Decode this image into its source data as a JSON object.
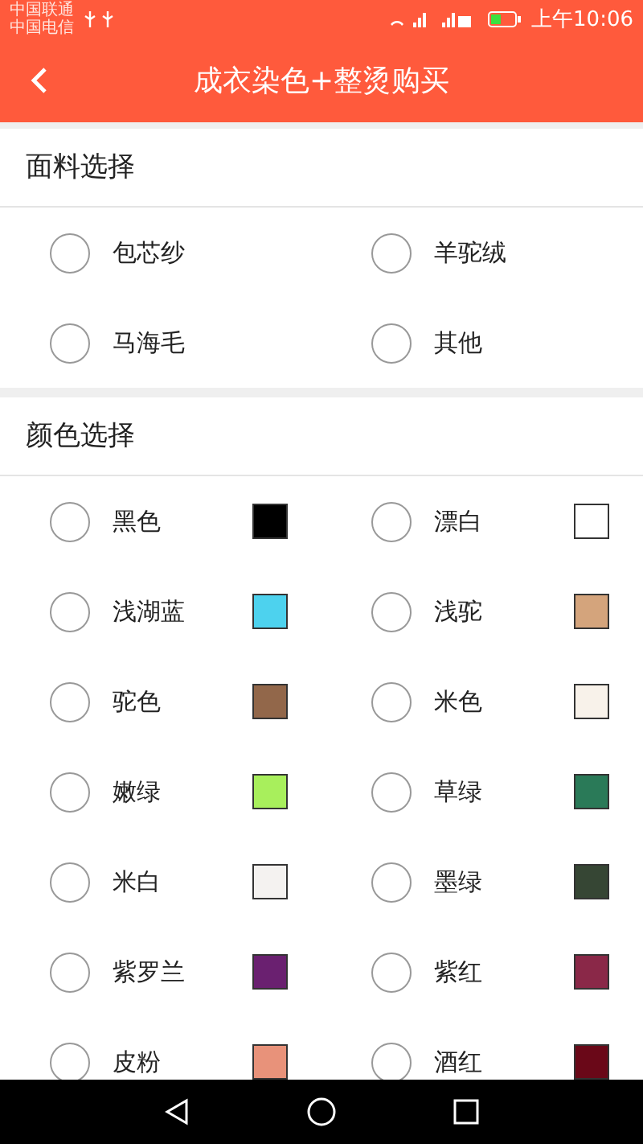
{
  "status_bar": {
    "carriers": [
      "中国联通",
      "中国电信"
    ],
    "time": "上午10:06"
  },
  "app_bar": {
    "title": "成衣染色+整烫购买"
  },
  "fabric_section": {
    "title": "面料选择",
    "options": [
      {
        "label": "包芯纱",
        "selected": false
      },
      {
        "label": "羊驼绒",
        "selected": false
      },
      {
        "label": "马海毛",
        "selected": false
      },
      {
        "label": "其他",
        "selected": false
      }
    ]
  },
  "color_section": {
    "title": "颜色选择",
    "options": [
      {
        "label": "黑色",
        "selected": false,
        "color": "#000000"
      },
      {
        "label": "漂白",
        "selected": false,
        "color": "#ffffff"
      },
      {
        "label": "浅湖蓝",
        "selected": false,
        "color": "#4dd2ee"
      },
      {
        "label": "浅驼",
        "selected": false,
        "color": "#d4a47c"
      },
      {
        "label": "驼色",
        "selected": false,
        "color": "#92674a"
      },
      {
        "label": "米色",
        "selected": false,
        "color": "#f8f2ea"
      },
      {
        "label": "嫩绿",
        "selected": false,
        "color": "#a8ef5c"
      },
      {
        "label": "草绿",
        "selected": false,
        "color": "#2a7a58"
      },
      {
        "label": "米白",
        "selected": false,
        "color": "#f4f2f0"
      },
      {
        "label": "墨绿",
        "selected": false,
        "color": "#364634"
      },
      {
        "label": "紫罗兰",
        "selected": false,
        "color": "#6a2070"
      },
      {
        "label": "紫红",
        "selected": false,
        "color": "#8a2848"
      },
      {
        "label": "皮粉",
        "selected": false,
        "color": "#e8927a"
      },
      {
        "label": "酒红",
        "selected": false,
        "color": "#6a0818"
      }
    ]
  }
}
